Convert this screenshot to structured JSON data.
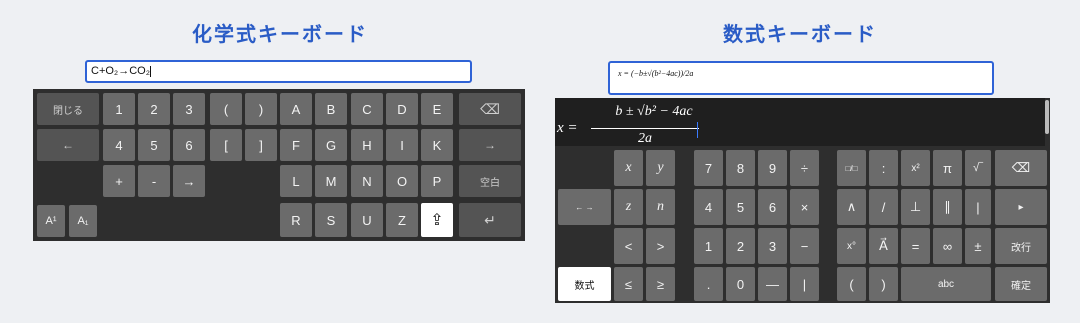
{
  "chem": {
    "title": "化学式キーボード",
    "input_value": "C+O₂→CO₂",
    "keys": {
      "close": "閉じる",
      "n1": "1",
      "n2": "2",
      "n3": "3",
      "lparen": "(",
      "rparen": ")",
      "A": "A",
      "B": "B",
      "C": "C",
      "D": "D",
      "E": "E",
      "backspace": "⌫",
      "left": "←",
      "n4": "4",
      "n5": "5",
      "n6": "6",
      "lbrack": "[",
      "rbrack": "]",
      "F": "F",
      "G": "G",
      "H": "H",
      "I": "I",
      "K": "K",
      "right": "→",
      "plus": "+",
      "minus": "-",
      "arrow": "→",
      "L": "L",
      "M": "M",
      "N": "N",
      "O": "O",
      "P": "P",
      "space": "空白",
      "sup": "A¹",
      "sub": "A₁",
      "R": "R",
      "S": "S",
      "U": "U",
      "Z": "Z",
      "shift": "⇪",
      "enter": "↵"
    }
  },
  "math": {
    "title": "数式キーボード",
    "input_value": "x = (−b±√(b²−4ac))/2a",
    "display": {
      "lhs": "x =",
      "numerator": "b ± √b² − 4ac",
      "denominator": "2a"
    },
    "keys": {
      "x": "x",
      "y": "y",
      "n7": "7",
      "n8": "8",
      "n9": "9",
      "div": "÷",
      "frac": "□/□",
      "colon": ":",
      "pow": "x²",
      "pi": "π",
      "sqrt": "√‾",
      "backspace": "⌫",
      "leftright": "← →",
      "z": "z",
      "n": "n",
      "n4": "4",
      "n5": "5",
      "n6": "6",
      "times": "×",
      "and": "∧",
      "slash": "/",
      "perp": "⊥",
      "parallel": "∥",
      "bar": "|",
      "next": "▸",
      "lt": "<",
      "gt": ">",
      "n1": "1",
      "n2": "2",
      "n3": "3",
      "minus": "−",
      "degree": "x°",
      "vector": "A⃗",
      "equals": "=",
      "infinity": "∞",
      "plusminus": "±",
      "newline": "改行",
      "numeric": "数式",
      "le": "≤",
      "ge": "≥",
      "dot": ".",
      "n0": "0",
      "dash": "—",
      "vert": "|",
      "lparen": "(",
      "rparen": ")",
      "abc": "abc",
      "convert": "確定"
    }
  }
}
